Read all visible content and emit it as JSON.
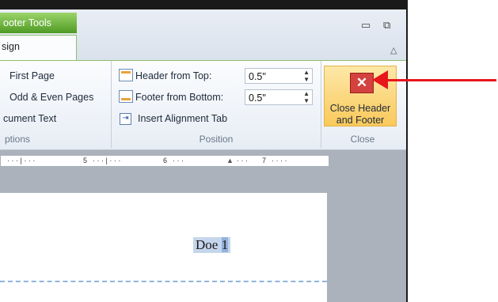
{
  "ribbon": {
    "context_tab": "ooter Tools",
    "active_tab": "sign",
    "options_group": {
      "items": [
        "First Page",
        "Odd & Even Pages",
        "cument Text"
      ],
      "label": "ptions"
    },
    "position_group": {
      "header_from_top_label": "Header from Top:",
      "header_from_top_value": "0.5\"",
      "footer_from_bottom_label": "Footer from Bottom:",
      "footer_from_bottom_value": "0.5\"",
      "insert_alignment_tab": "Insert Alignment Tab",
      "label": "Position"
    },
    "close_group": {
      "button_line1": "Close Header",
      "button_line2": "and Footer",
      "label": "Close"
    }
  },
  "ruler": {
    "marks": [
      "5",
      "6",
      "7"
    ]
  },
  "document": {
    "header_text": "Doe",
    "page_number": "1"
  },
  "annotation": {
    "arrow_color": "#e8151b"
  }
}
